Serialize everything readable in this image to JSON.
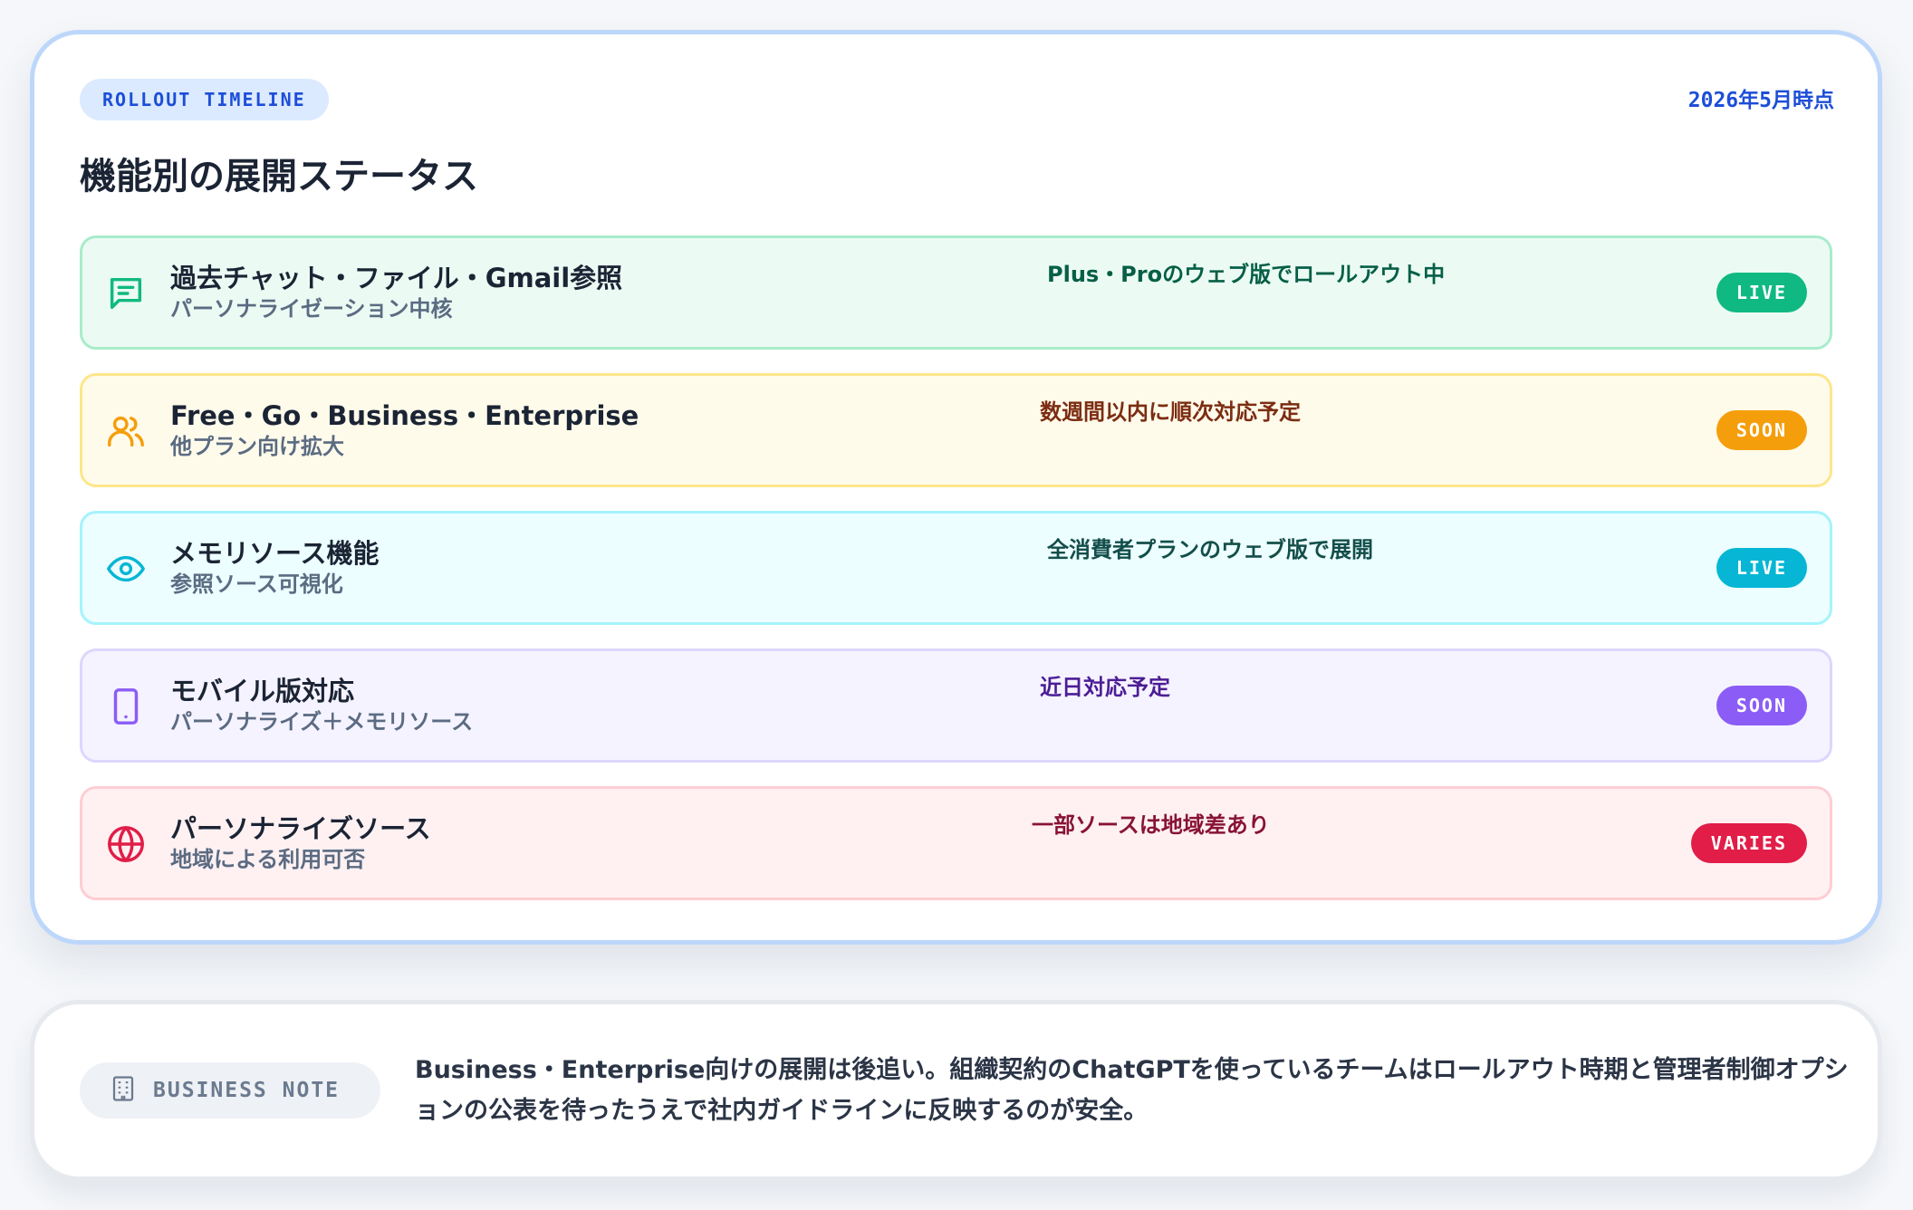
{
  "header": {
    "tag": "ROLLOUT TIMELINE",
    "as_of": "2026年5月時点",
    "title": "機能別の展開ステータス"
  },
  "rows": [
    {
      "name": "過去チャット・ファイル・Gmail参照",
      "sub": "パーソナライゼーション中核",
      "status": "Plus・Proのウェブ版でロールアウト中",
      "badge": "LIVE",
      "icon": "chat-icon",
      "colors": {
        "bg": "#ebfbf3",
        "border": "#a8eccb",
        "accent": "#10b981",
        "status": "#065f46"
      }
    },
    {
      "name": "Free・Go・Business・Enterprise",
      "sub": "他プラン向け拡大",
      "status": "数週間以内に順次対応予定",
      "badge": "SOON",
      "icon": "users-icon",
      "colors": {
        "bg": "#fffbeb",
        "border": "#fde68a",
        "accent": "#f59e0b",
        "status": "#7c2d12"
      }
    },
    {
      "name": "メモリソース機能",
      "sub": "参照ソース可視化",
      "status": "全消費者プランのウェブ版で展開",
      "badge": "LIVE",
      "icon": "eye-icon",
      "colors": {
        "bg": "#ecfeff",
        "border": "#a5f3fc",
        "accent": "#06b6d4",
        "status": "#134e4a"
      }
    },
    {
      "name": "モバイル版対応",
      "sub": "パーソナライズ＋メモリソース",
      "status": "近日対応予定",
      "badge": "SOON",
      "icon": "mobile-icon",
      "colors": {
        "bg": "#f5f3ff",
        "border": "#ddd6fe",
        "accent": "#8b5cf6",
        "status": "#4c1d95"
      }
    },
    {
      "name": "パーソナライズソース",
      "sub": "地域による利用可否",
      "status": "一部ソースは地域差あり",
      "badge": "VARIES",
      "icon": "globe-icon",
      "colors": {
        "bg": "#fff1f2",
        "border": "#fecdd3",
        "accent": "#e11d48",
        "status": "#881337"
      }
    }
  ],
  "note": {
    "label": "BUSINESS NOTE",
    "icon": "building-icon",
    "text": "Business・Enterprise向けの展開は後追い。組織契約のChatGPTを使っているチームはロールアウト時期と管理者制御オプションの公表を待ったうえで社内ガイドラインに反映するのが安全。"
  }
}
